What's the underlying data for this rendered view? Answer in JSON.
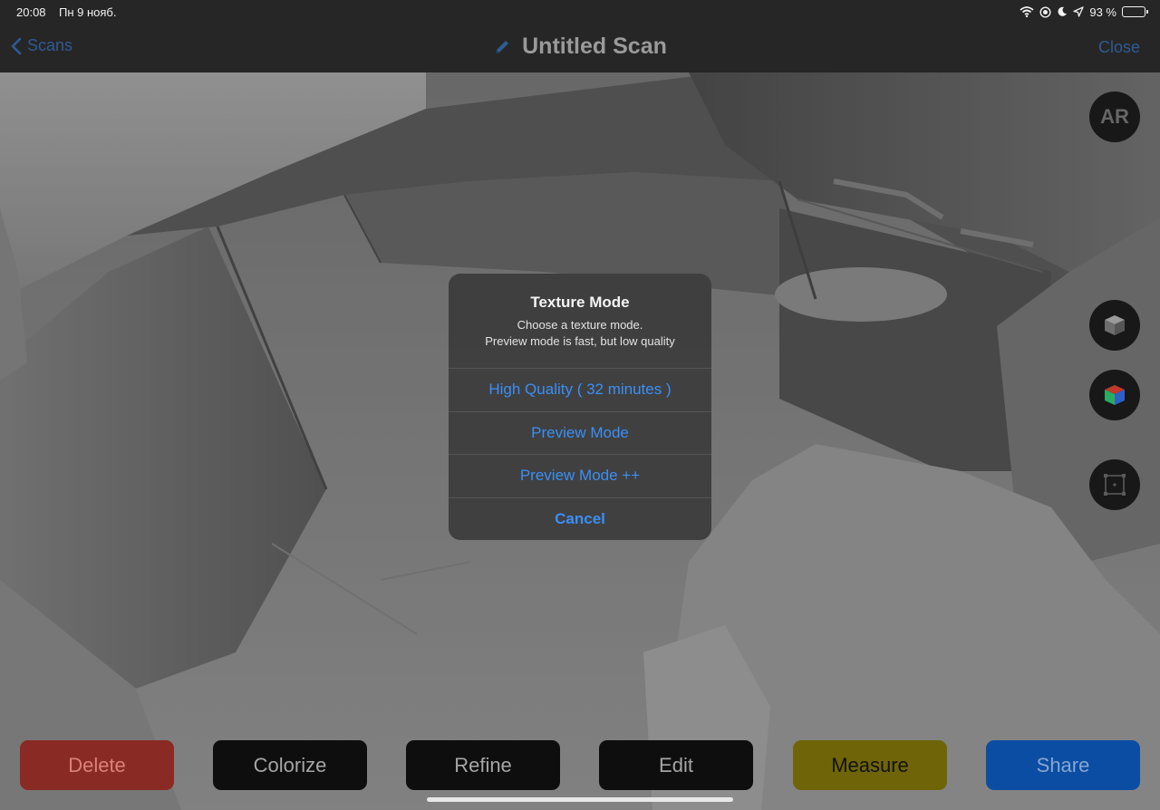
{
  "status_bar": {
    "time": "20:08",
    "date": "Пн 9 нояб.",
    "battery_percent": "93 %",
    "battery_level": 0.93,
    "icons": [
      "wifi-icon",
      "screen-record-icon",
      "moon-icon",
      "location-icon",
      "battery-icon"
    ]
  },
  "nav": {
    "back_label": "Scans",
    "title": "Untitled Scan",
    "close_label": "Close",
    "accent_color": "#2f5b93"
  },
  "side_buttons": {
    "ar_label": "AR",
    "icons": [
      "gray-cube-icon",
      "color-cube-icon",
      "bounding-box-icon"
    ]
  },
  "toolbar": {
    "delete_label": "Delete",
    "colorize_label": "Colorize",
    "refine_label": "Refine",
    "edit_label": "Edit",
    "measure_label": "Measure",
    "share_label": "Share",
    "colors": {
      "delete": "#8a2a24",
      "measure": "#6f6508",
      "share": "#0b4da2"
    }
  },
  "alert": {
    "title": "Texture Mode",
    "message_line1": "Choose a texture mode.",
    "message_line2": "Preview mode is fast, but low quality",
    "options": [
      {
        "label": "High Quality ( 32 minutes )"
      },
      {
        "label": "Preview Mode"
      },
      {
        "label": "Preview Mode ++"
      }
    ],
    "cancel_label": "Cancel",
    "button_color": "#3b8ff5"
  }
}
